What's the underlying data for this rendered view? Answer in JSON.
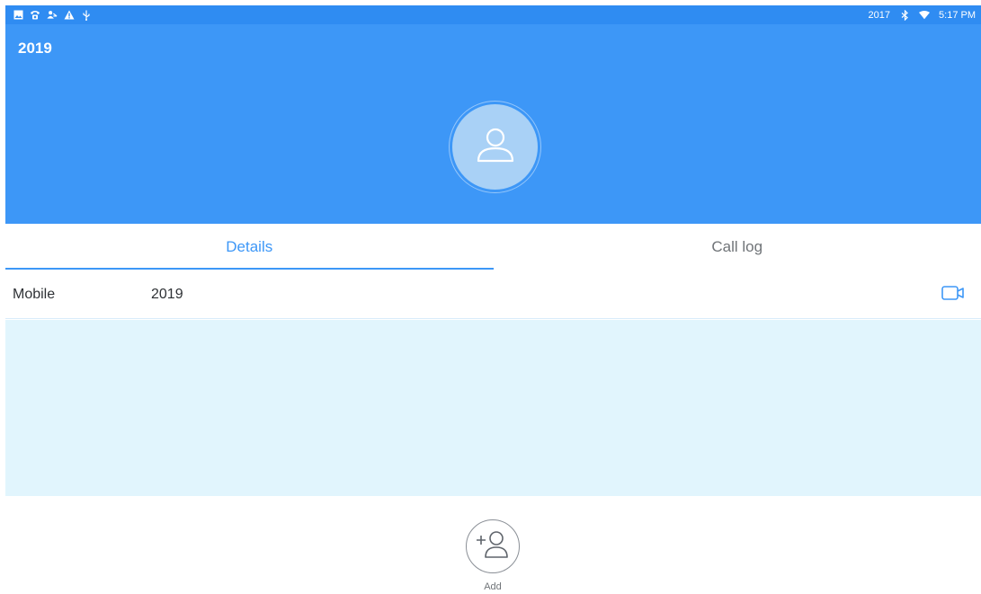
{
  "status_bar": {
    "left_icons": [
      "image-icon",
      "phone-icon",
      "contacts-icon",
      "warning-icon",
      "usb-icon"
    ],
    "right_text": "2017",
    "time": "5:17 PM",
    "bg_color": "#2f8cf2"
  },
  "header": {
    "title": "2019",
    "bg_color": "#3d97f7",
    "avatar_icon": "person-icon"
  },
  "tabs": [
    {
      "label": "Details",
      "active": true
    },
    {
      "label": "Call log",
      "active": false
    }
  ],
  "detail": {
    "label": "Mobile",
    "value": "2019",
    "action_icon": "video-call-icon"
  },
  "add_button": {
    "label": "Add",
    "icon": "add-contact-icon"
  },
  "colors": {
    "accent": "#3d97f7",
    "panel": "#e1f5fd"
  }
}
